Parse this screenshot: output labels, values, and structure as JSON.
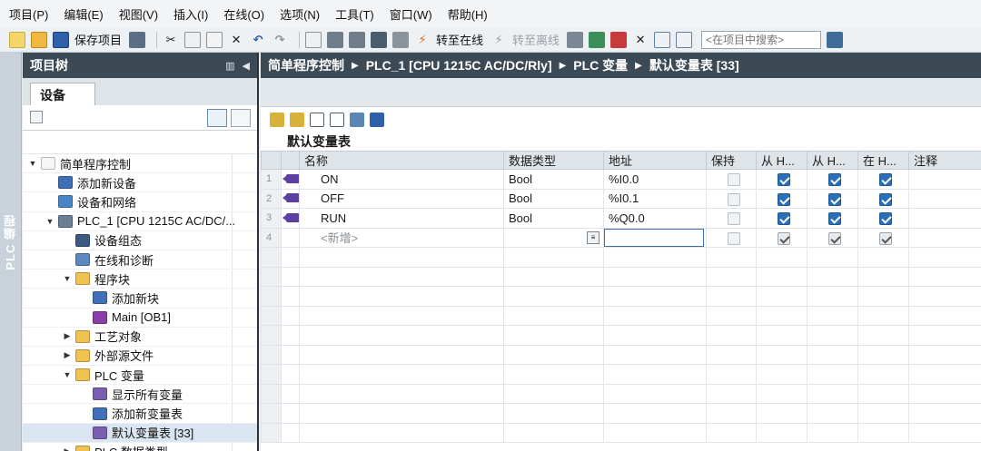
{
  "menu": [
    "项目(P)",
    "编辑(E)",
    "视图(V)",
    "插入(I)",
    "在线(O)",
    "选项(N)",
    "工具(T)",
    "窗口(W)",
    "帮助(H)"
  ],
  "toolbar": {
    "save_project": "保存项目",
    "go_online": "转至在线",
    "go_offline": "转至离线",
    "search_placeholder": "<在项目中搜索>"
  },
  "left_strip": {
    "label": "PLC 编程"
  },
  "project_tree": {
    "title": "项目树",
    "tab": "设备",
    "items": [
      {
        "label": "简单程序控制",
        "level": 0,
        "toggle": "▼",
        "icon": "project-icon"
      },
      {
        "label": "添加新设备",
        "level": 1,
        "toggle": "",
        "icon": "add-device-icon"
      },
      {
        "label": "设备和网络",
        "level": 1,
        "toggle": "",
        "icon": "network-icon"
      },
      {
        "label": "PLC_1 [CPU 1215C AC/DC/...",
        "level": 1,
        "toggle": "▼",
        "icon": "plc-icon"
      },
      {
        "label": "设备组态",
        "level": 2,
        "toggle": "",
        "icon": "device-config-icon"
      },
      {
        "label": "在线和诊断",
        "level": 2,
        "toggle": "",
        "icon": "diagnostics-icon"
      },
      {
        "label": "程序块",
        "level": 2,
        "toggle": "▼",
        "icon": "folder-icon"
      },
      {
        "label": "添加新块",
        "level": 3,
        "toggle": "",
        "icon": "add-block-icon"
      },
      {
        "label": "Main [OB1]",
        "level": 3,
        "toggle": "",
        "icon": "ob-block-icon"
      },
      {
        "label": "工艺对象",
        "level": 2,
        "toggle": "▶",
        "icon": "folder-icon"
      },
      {
        "label": "外部源文件",
        "level": 2,
        "toggle": "▶",
        "icon": "folder-icon"
      },
      {
        "label": "PLC 变量",
        "level": 2,
        "toggle": "▼",
        "icon": "folder-icon"
      },
      {
        "label": "显示所有变量",
        "level": 3,
        "toggle": "",
        "icon": "show-tags-icon"
      },
      {
        "label": "添加新变量表",
        "level": 3,
        "toggle": "",
        "icon": "add-tag-table-icon"
      },
      {
        "label": "默认变量表 [33]",
        "level": 3,
        "toggle": "",
        "icon": "tag-table-icon",
        "selected": true
      },
      {
        "label": "PLC 数据类型",
        "level": 2,
        "toggle": "▶",
        "icon": "folder-icon"
      }
    ]
  },
  "breadcrumb": [
    "简单程序控制",
    "PLC_1 [CPU 1215C AC/DC/Rly]",
    "PLC 变量",
    "默认变量表 [33]"
  ],
  "table": {
    "title": "默认变量表",
    "headers": [
      "名称",
      "数据类型",
      "地址",
      "保持",
      "从 H...",
      "从 H...",
      "在 H...",
      "注释"
    ],
    "rows": [
      {
        "num": "1",
        "name": "ON",
        "type": "Bool",
        "address": "%I0.0"
      },
      {
        "num": "2",
        "name": "OFF",
        "type": "Bool",
        "address": "%I0.1"
      },
      {
        "num": "3",
        "name": "RUN",
        "type": "Bool",
        "address": "%Q0.0"
      }
    ],
    "new_row": {
      "num": "4",
      "name": "<新增>"
    }
  },
  "colors": {
    "header_bg": "#3c4a56",
    "checkbox_blue": "#2a6fb8",
    "tag_icon": "#5b3fa3"
  }
}
